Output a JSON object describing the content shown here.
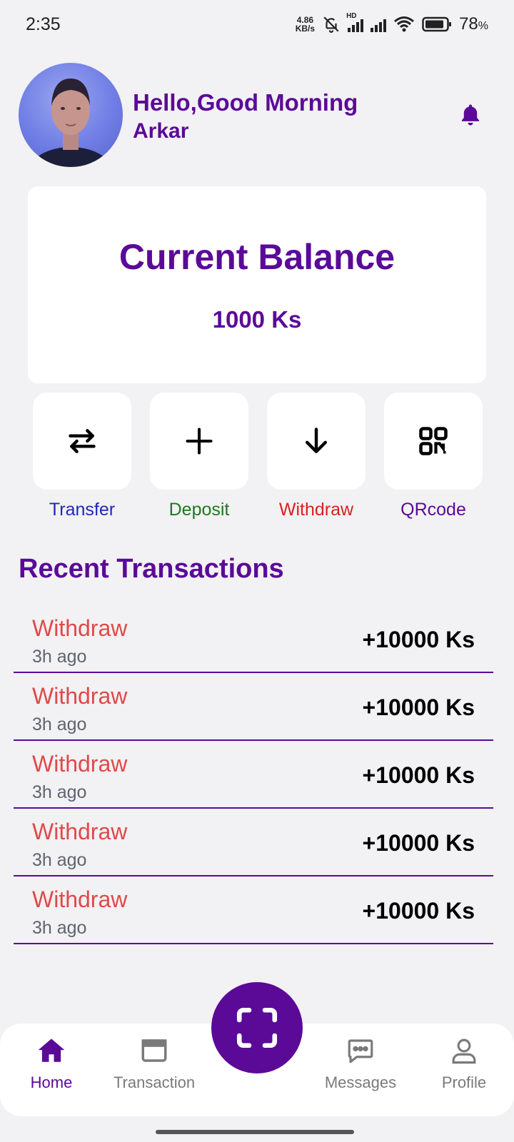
{
  "status_bar": {
    "time": "2:35",
    "net_speed_value": "4.86",
    "net_speed_unit": "KB/s",
    "signal_label": "HD",
    "battery_percent": "78",
    "battery_unit": "%"
  },
  "header": {
    "greeting": "Hello,Good Morning",
    "username": "Arkar",
    "bell_icon": "bell-icon"
  },
  "balance": {
    "title": "Current Balance",
    "amount": "1000 Ks"
  },
  "actions": [
    {
      "label": "Transfer",
      "icon": "transfer-arrows-icon",
      "color": "#1f28b8"
    },
    {
      "label": "Deposit",
      "icon": "plus-icon",
      "color": "#1d7a1d"
    },
    {
      "label": "Withdraw",
      "icon": "arrow-down-icon",
      "color": "#d92121"
    },
    {
      "label": "QRcode",
      "icon": "qr-code-icon",
      "color": "#5b0a98"
    }
  ],
  "recent": {
    "title": "Recent Transactions",
    "items": [
      {
        "type": "Withdraw",
        "time": "3h ago",
        "amount": "+10000 Ks"
      },
      {
        "type": "Withdraw",
        "time": "3h ago",
        "amount": "+10000 Ks"
      },
      {
        "type": "Withdraw",
        "time": "3h ago",
        "amount": "+10000 Ks"
      },
      {
        "type": "Withdraw",
        "time": "3h ago",
        "amount": "+10000 Ks"
      },
      {
        "type": "Withdraw",
        "time": "3h ago",
        "amount": "+10000 Ks"
      }
    ]
  },
  "nav": {
    "items": [
      {
        "label": "Home",
        "icon": "home-icon",
        "active": true
      },
      {
        "label": "Transaction",
        "icon": "window-icon",
        "active": false
      },
      {
        "label": "Messages",
        "icon": "chat-bubble-icon",
        "active": false
      },
      {
        "label": "Profile",
        "icon": "person-icon",
        "active": false
      }
    ],
    "scan_icon": "scan-icon"
  },
  "colors": {
    "brand_purple": "#5b0a98",
    "withdraw_red": "#de4a4a",
    "background": "#f2f1f3"
  }
}
